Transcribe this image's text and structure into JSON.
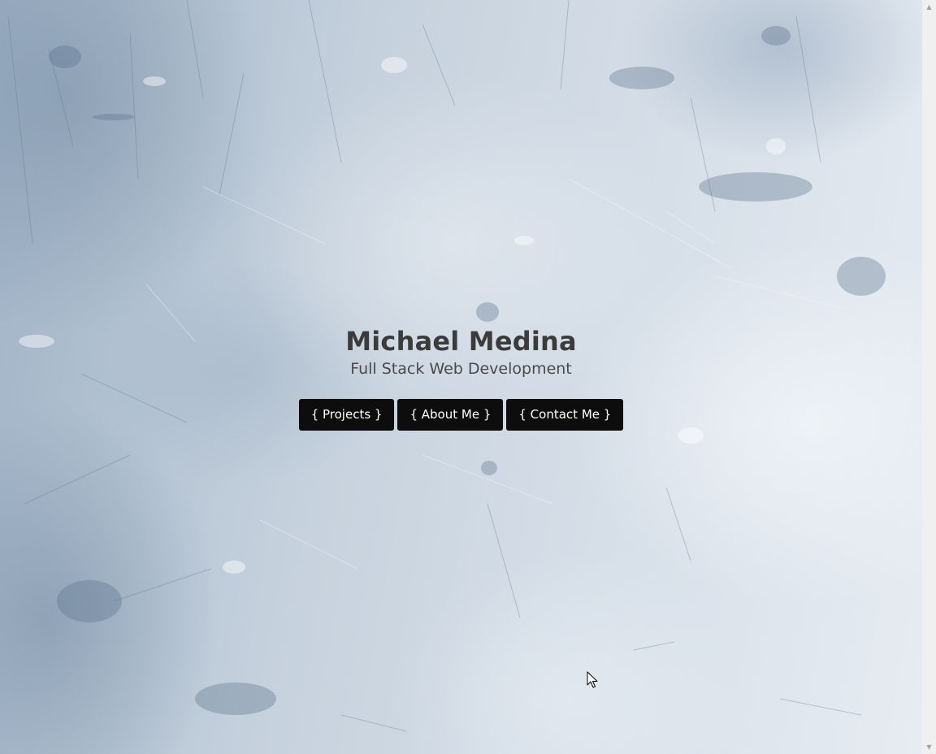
{
  "hero": {
    "name": "Michael Medina",
    "subtitle": "Full Stack Web Development"
  },
  "nav": {
    "projects_label": "{ Projects }",
    "about_label": "{ About Me }",
    "contact_label": "{ Contact Me }"
  },
  "scrollbar": {
    "up_arrow_icon": "scroll-up-arrow-icon",
    "down_arrow_icon": "scroll-down-arrow-icon"
  },
  "cursor_icon": "mouse-pointer-icon",
  "colors": {
    "button_background": "#0d0d0d",
    "button_text": "#ffffff",
    "title_text": "#3b3b3b",
    "subtitle_text": "#4a4a4a",
    "background": "#c6d2de"
  }
}
